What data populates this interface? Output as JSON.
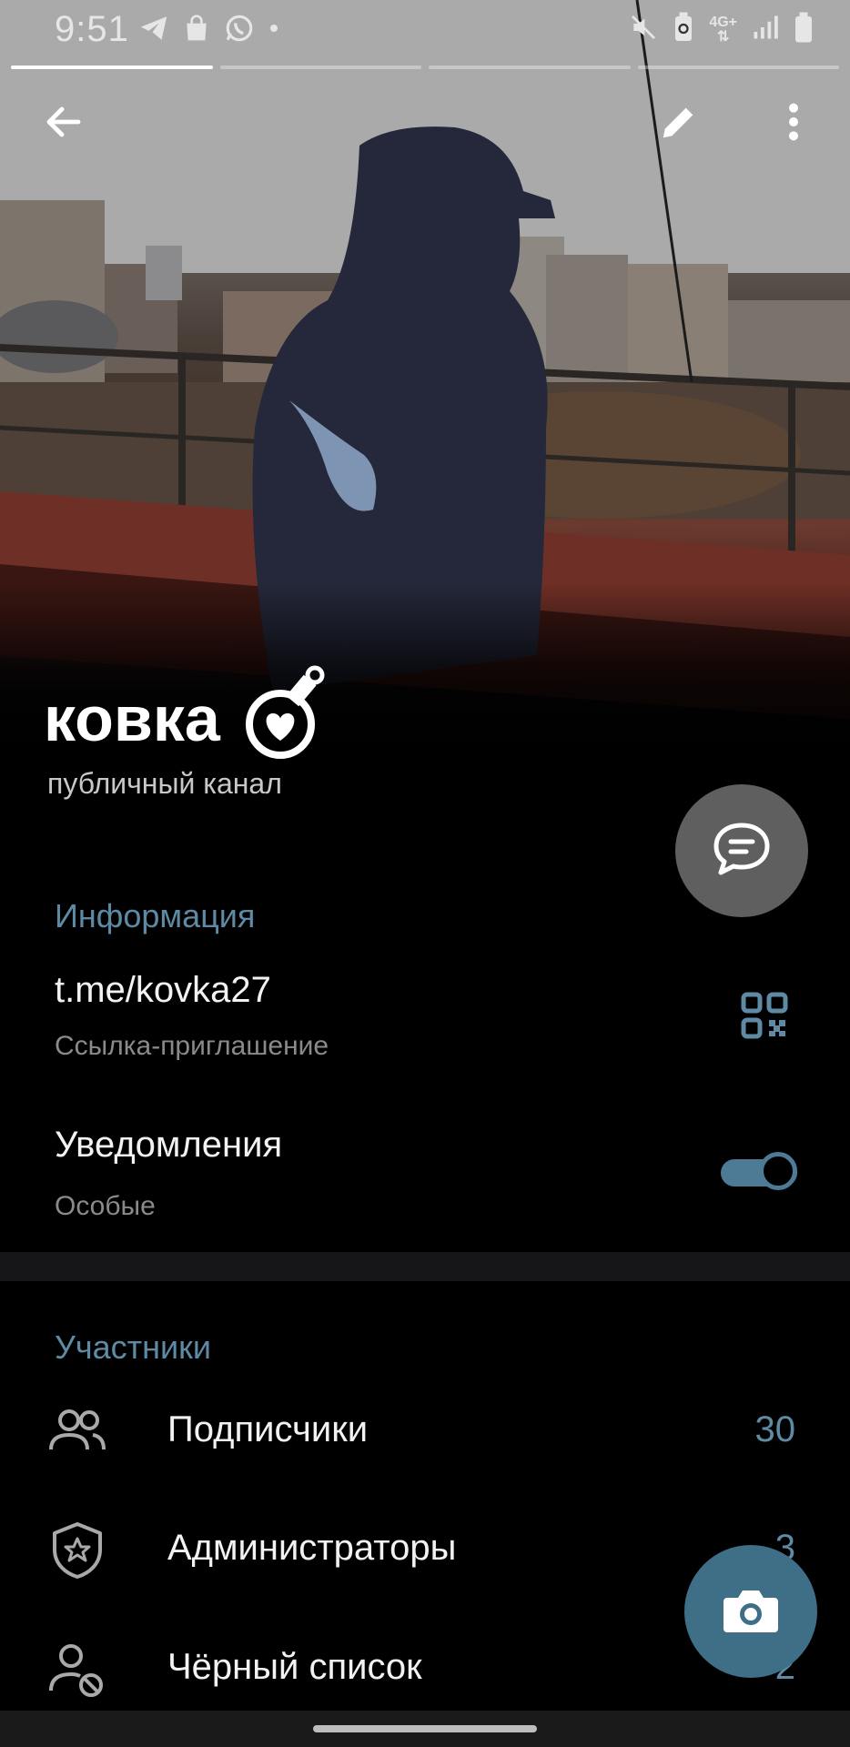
{
  "status_bar": {
    "time": "9:51",
    "left_icons": [
      "telegram-icon",
      "shopping-bag-icon",
      "whatsapp-icon",
      "dot-icon"
    ],
    "right_icons": [
      "mute-icon",
      "battery-saver-icon",
      "network-icon",
      "signal-icon",
      "battery-icon"
    ],
    "network_label": "4G+"
  },
  "story_progress": {
    "segments": 4,
    "active_index": 0
  },
  "top_bar": {
    "back_icon": "arrow-left-icon",
    "edit_icon": "pencil-icon",
    "menu_icon": "more-vertical-icon"
  },
  "profile": {
    "name": "ковка",
    "emoji_icon": "heart-potion-icon",
    "subtitle": "публичный канал"
  },
  "info_section": {
    "heading": "Информация",
    "link": "t.me/kovka27",
    "link_caption": "Ссылка-приглашение",
    "notifications_label": "Уведомления",
    "notifications_value": "Особые",
    "notifications_enabled": true
  },
  "members_section": {
    "heading": "Участники",
    "rows": [
      {
        "icon": "people-icon",
        "label": "Подписчики",
        "count": "30"
      },
      {
        "icon": "shield-star-icon",
        "label": "Администраторы",
        "count": "3"
      },
      {
        "icon": "user-blocked-icon",
        "label": "Чёрный список",
        "count": "2"
      }
    ]
  },
  "colors": {
    "accent": "#5f8aa4",
    "toggle": "#4d7b96",
    "camera_fab": "#3f6f87",
    "chat_fab": "#5f5f60"
  }
}
